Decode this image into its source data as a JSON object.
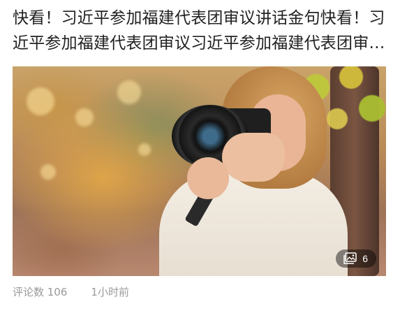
{
  "article": {
    "headline": "快看！习近平参加福建代表团审议讲话金句快看！习近平参加福建代表团审议习近平参加福建代表团审议讲话金句",
    "image_count": "6",
    "comments": "评论数 106",
    "time": "1小时前"
  },
  "icons": {
    "gallery": "gallery-icon"
  },
  "colors": {
    "headline": "#222222",
    "meta": "#9a9a9a",
    "badge_bg": "rgba(0,0,0,0.45)"
  }
}
